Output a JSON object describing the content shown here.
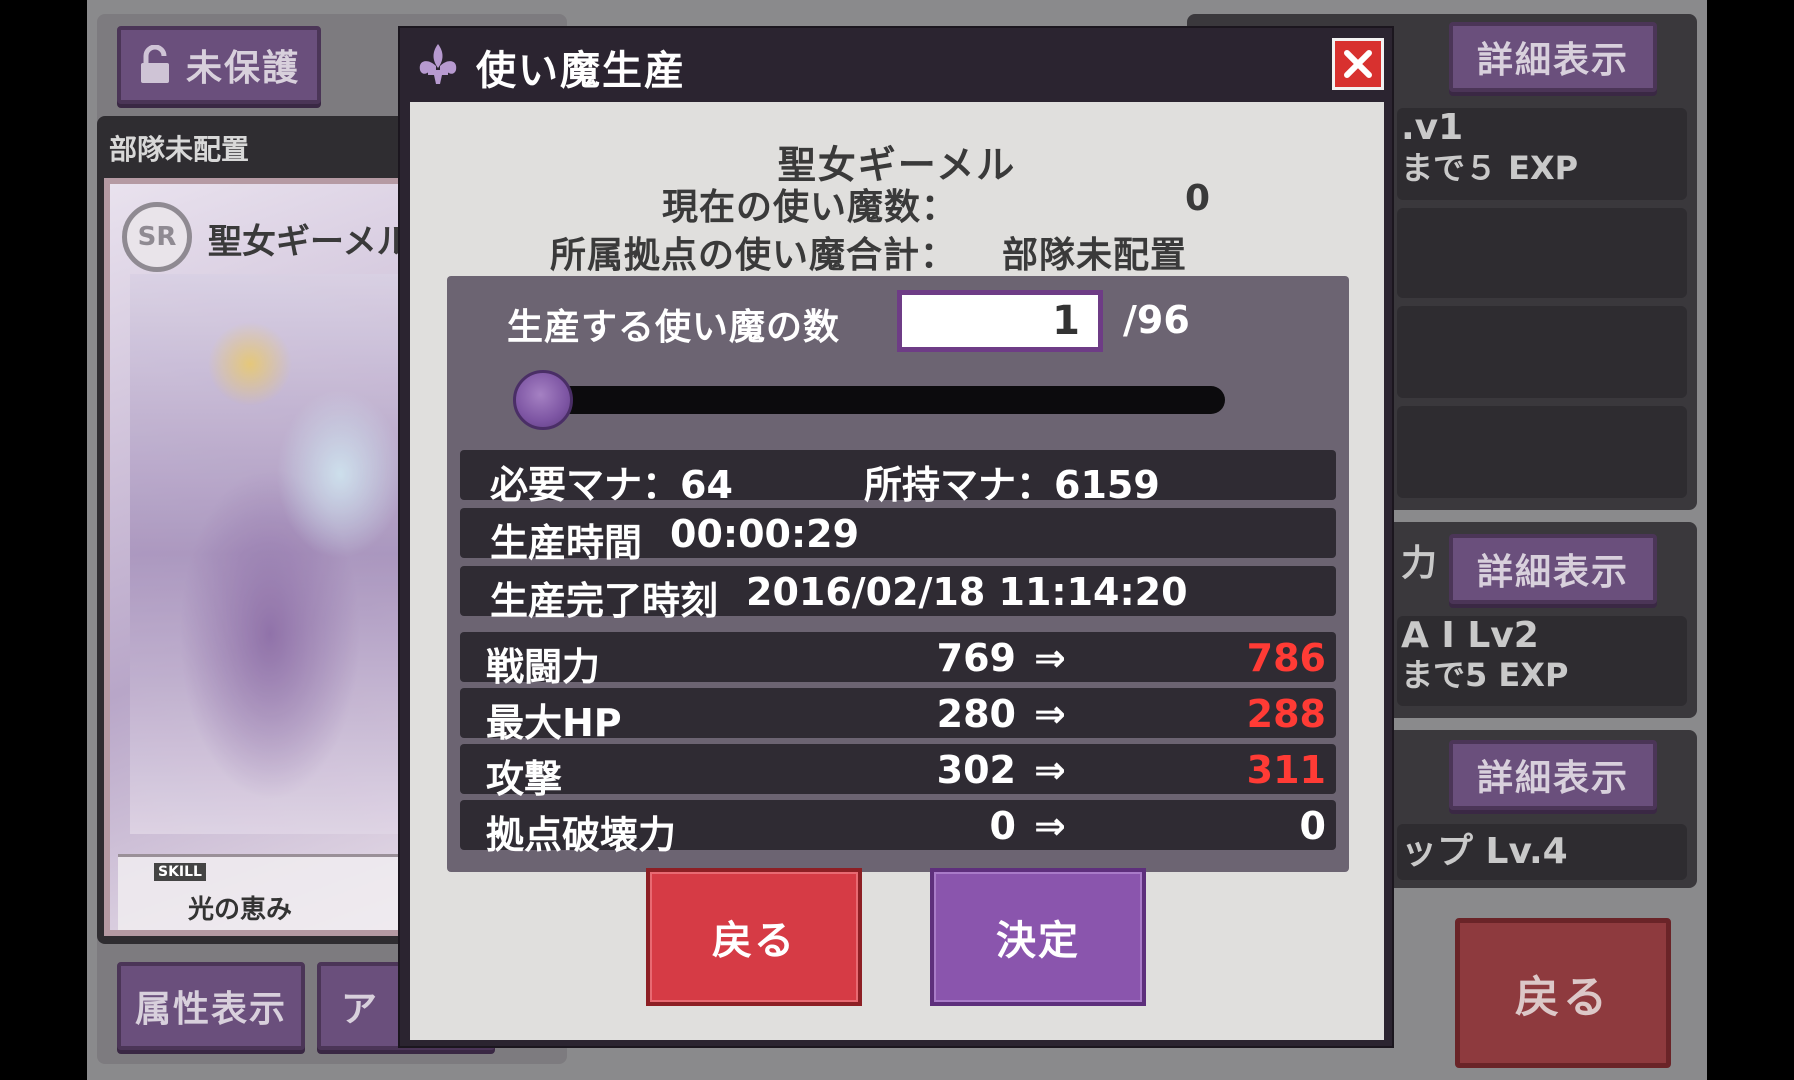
{
  "background": {
    "protect_button": "未保護",
    "unit_status": "部隊未配置",
    "card_name": "聖女ギーメル",
    "card_rarity": "SR",
    "skill_tag": "SKILL",
    "skill_name": "光の恵み",
    "attr_button": "属性表示",
    "other_button_partial": "ア",
    "detail_buttons": [
      "詳細表示",
      "詳細表示",
      "詳細表示"
    ],
    "right_rows": [
      {
        "line1": ".v1",
        "line2": "まで５ EXP"
      },
      {
        "line1": "力"
      },
      {
        "line1": "A I Lv2",
        "line2": "まで5 EXP"
      },
      {
        "line1": "ップ Lv.4"
      }
    ],
    "back_button": "戻る"
  },
  "dialog": {
    "title": "使い魔生産",
    "name": "聖女ギーメル",
    "current_label": "現在の使い魔数：",
    "current_value": "0",
    "total_label": "所属拠点の使い魔合計：",
    "total_value": "部隊未配置",
    "produce_label": "生産する使い魔の数",
    "produce_count": "1",
    "produce_max": "/96",
    "slider_value": 1,
    "slider_max": 96,
    "mana_required_label": "必要マナ：64",
    "mana_owned_label": "所持マナ：6159",
    "time_label": "生産時間",
    "time_value": "00:00:29",
    "complete_label": "生産完了時刻",
    "complete_value": "2016/02/18 11:14:20",
    "arrow": "⇒",
    "stats": [
      {
        "label": "戦闘力",
        "before": "769",
        "after": "786",
        "changed": true
      },
      {
        "label": "最大HP",
        "before": "280",
        "after": "288",
        "changed": true
      },
      {
        "label": "攻撃",
        "before": "302",
        "after": "311",
        "changed": true
      },
      {
        "label": "拠点破壊力",
        "before": "0",
        "after": "0",
        "changed": false
      }
    ],
    "back_button": "戻る",
    "ok_button": "決定"
  },
  "colors": {
    "accent_purple": "#8a55ad",
    "back_red": "#d63b45",
    "increase_red": "#ff3b35"
  }
}
